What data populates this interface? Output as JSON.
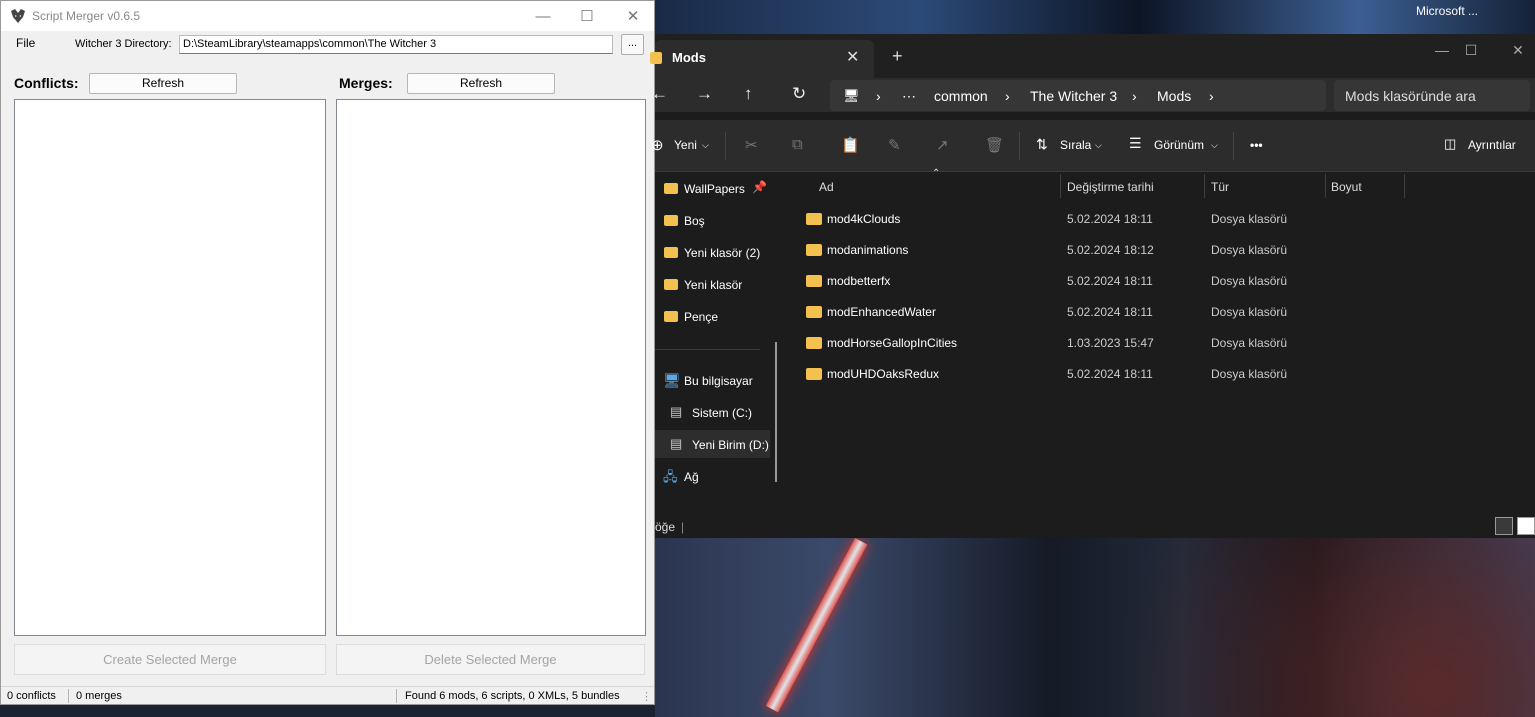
{
  "desktop": {
    "taskbar_label": "Microsoft ..."
  },
  "script_merger": {
    "title": "Script Merger v0.6.5",
    "menu_file": "File",
    "dir_label": "Witcher 3 Directory:",
    "dir_value": "D:\\SteamLibrary\\steamapps\\common\\The Witcher 3",
    "browse_label": "...",
    "conflicts_label": "Conflicts:",
    "merges_label": "Merges:",
    "refresh_label": "Refresh",
    "create_merge_label": "Create Selected Merge",
    "delete_merge_label": "Delete Selected Merge",
    "status": {
      "conflicts": "0 conflicts",
      "merges": "0 merges",
      "found": "Found 6 mods, 6 scripts, 0 XMLs, 5 bundles"
    }
  },
  "explorer": {
    "tab_title": "Mods",
    "breadcrumb": [
      "common",
      "The Witcher 3",
      "Mods"
    ],
    "search_placeholder": "Mods klasöründe ara",
    "commands": {
      "new": "Yeni",
      "sort": "Sırala",
      "view": "Görünüm",
      "more": "•••",
      "details": "Ayrıntılar"
    },
    "nav_items": [
      {
        "label": "WallPapers",
        "icon": "folder-icon",
        "pinned": true
      },
      {
        "label": "Boş",
        "icon": "folder-icon"
      },
      {
        "label": "Yeni klasör (2)",
        "icon": "folder-icon"
      },
      {
        "label": "Yeni klasör",
        "icon": "folder-icon"
      },
      {
        "label": "Pençe",
        "icon": "folder-icon"
      },
      {
        "label": "Bu bilgisayar",
        "icon": "computer-icon"
      },
      {
        "label": "Sistem (C:)",
        "icon": "drive-icon"
      },
      {
        "label": "Yeni Birim (D:)",
        "icon": "drive-icon",
        "selected": true
      },
      {
        "label": "Ağ",
        "icon": "network-icon"
      }
    ],
    "columns": [
      "Ad",
      "Değiştirme tarihi",
      "Tür",
      "Boyut"
    ],
    "files": [
      {
        "name": "mod4kClouds",
        "date": "5.02.2024 18:11",
        "type": "Dosya klasörü"
      },
      {
        "name": "modanimations",
        "date": "5.02.2024 18:12",
        "type": "Dosya klasörü"
      },
      {
        "name": "modbetterfx",
        "date": "5.02.2024 18:11",
        "type": "Dosya klasörü"
      },
      {
        "name": "modEnhancedWater",
        "date": "5.02.2024 18:11",
        "type": "Dosya klasörü"
      },
      {
        "name": "modHorseGallopInCities",
        "date": "1.03.2023 15:47",
        "type": "Dosya klasörü"
      },
      {
        "name": "modUHDOaksRedux",
        "date": "5.02.2024 18:11",
        "type": "Dosya klasörü"
      }
    ],
    "status_text": "öğe"
  }
}
